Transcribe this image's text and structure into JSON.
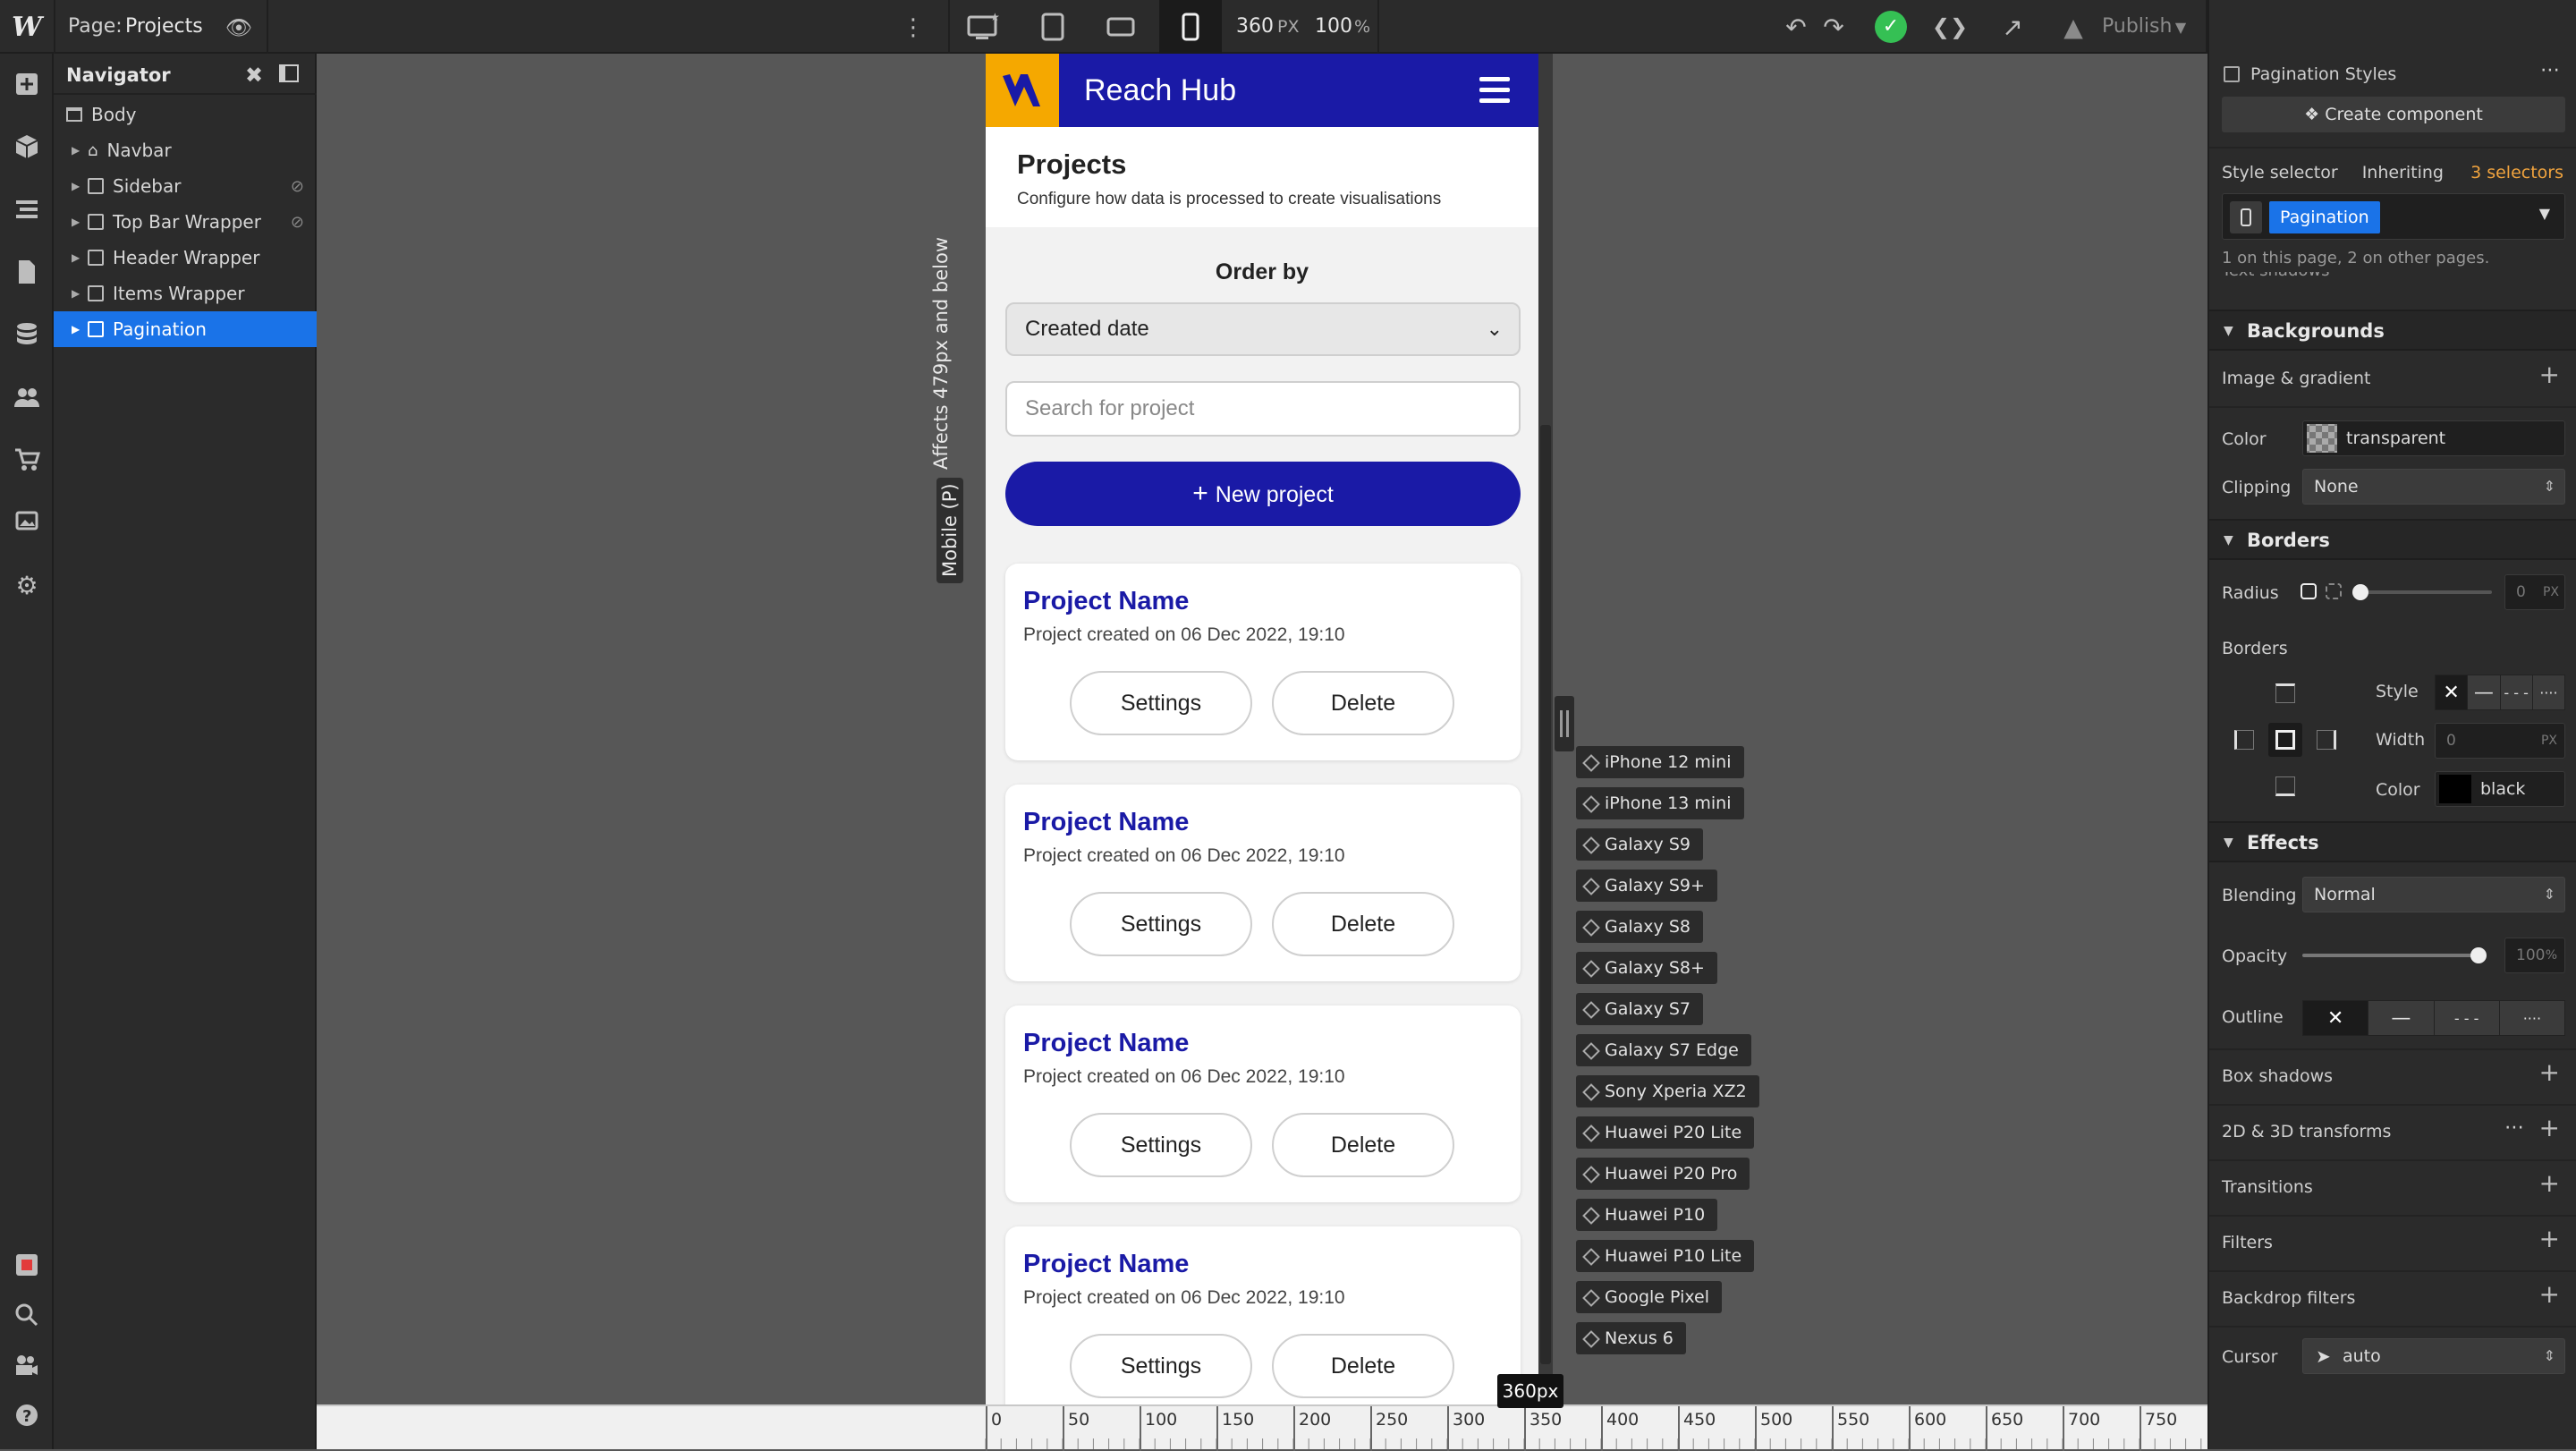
{
  "topbar": {
    "page_prefix": "Page:",
    "page_name": "Projects",
    "width_value": "360",
    "width_unit": "PX",
    "zoom_value": "100",
    "zoom_unit": "%",
    "publish_label": "Publish"
  },
  "left_icons": [
    "add-icon",
    "cube-icon",
    "list-icon",
    "page-icon",
    "database-icon",
    "users-icon",
    "cart-icon",
    "image-icon",
    "gear-icon",
    "record-icon",
    "search-icon",
    "video-icon",
    "help-icon"
  ],
  "navigator": {
    "title": "Navigator",
    "items": [
      {
        "label": "Body"
      },
      {
        "label": "Navbar"
      },
      {
        "label": "Sidebar"
      },
      {
        "label": "Top Bar Wrapper"
      },
      {
        "label": "Header Wrapper"
      },
      {
        "label": "Items Wrapper"
      },
      {
        "label": "Pagination"
      }
    ]
  },
  "canvas": {
    "breakpoint_note": "Affects 479px and below",
    "breakpoint_name": "Mobile (P)"
  },
  "app": {
    "brand": "Reach Hub",
    "page_title": "Projects",
    "page_subtitle": "Configure how data is processed to create visualisations",
    "order_label": "Order by",
    "order_value": "Created date",
    "search_placeholder": "Search for project",
    "new_button": "New project",
    "projects": [
      {
        "name": "Project Name",
        "created": "Project created on 06 Dec 2022, 19:10",
        "settings": "Settings",
        "delete": "Delete"
      },
      {
        "name": "Project Name",
        "created": "Project created on 06 Dec 2022, 19:10",
        "settings": "Settings",
        "delete": "Delete"
      },
      {
        "name": "Project Name",
        "created": "Project created on 06 Dec 2022, 19:10",
        "settings": "Settings",
        "delete": "Delete"
      },
      {
        "name": "Project Name",
        "created": "Project created on 06 Dec 2022, 19:10",
        "settings": "Settings",
        "delete": "Delete"
      }
    ],
    "brand_color": "#1a1aa6",
    "logo_color": "#f5a800"
  },
  "devices": [
    "iPhone 12 mini",
    "iPhone 13 mini",
    "Galaxy S9",
    "Galaxy S9+",
    "Galaxy S8",
    "Galaxy S8+",
    "Galaxy S7",
    "Galaxy S7 Edge",
    "Sony Xperia XZ2",
    "Huawei P20 Lite",
    "Huawei P20 Pro",
    "Huawei P10",
    "Huawei P10 Lite",
    "Google Pixel",
    "Nexus 6"
  ],
  "ruler": {
    "ticks": [
      "0",
      "50",
      "100",
      "150",
      "200",
      "250",
      "300",
      "350",
      "400",
      "450",
      "500",
      "550",
      "600",
      "650",
      "700",
      "750"
    ],
    "tooltip": "360px"
  },
  "panel": {
    "component_name": "Pagination Styles",
    "create_component": "Create component",
    "style_selector_label": "Style selector",
    "inheriting_prefix": "Inheriting",
    "inheriting_count": "3 selectors",
    "selector_tag": "Pagination",
    "selector_usage": "1 on this page, 2 on other pages.",
    "clipped_row": "Text shadows",
    "backgrounds": {
      "title": "Backgrounds",
      "image_gradient": "Image & gradient",
      "color_label": "Color",
      "color_value": "transparent",
      "clipping_label": "Clipping",
      "clipping_value": "None"
    },
    "borders": {
      "title": "Borders",
      "radius_label": "Radius",
      "radius_value": "0",
      "radius_unit": "PX",
      "borders_label": "Borders",
      "style_label": "Style",
      "width_label": "Width",
      "width_value": "0",
      "width_unit": "PX",
      "color_label": "Color",
      "color_value": "black"
    },
    "effects": {
      "title": "Effects",
      "blending_label": "Blending",
      "blending_value": "Normal",
      "opacity_label": "Opacity",
      "opacity_value": "100",
      "opacity_unit": "%",
      "outline_label": "Outline",
      "box_shadows": "Box shadows",
      "transforms": "2D & 3D transforms",
      "transitions": "Transitions",
      "filters": "Filters",
      "backdrop_filters": "Backdrop filters",
      "cursor_label": "Cursor",
      "cursor_value": "auto"
    },
    "accent_color": "#1a73e8",
    "inherit_color": "#f0a33e"
  }
}
